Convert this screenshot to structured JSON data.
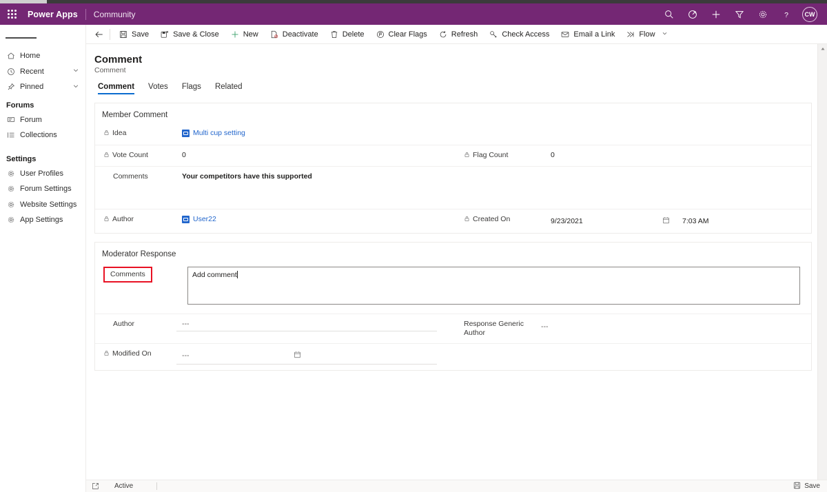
{
  "topbar": {
    "waffle_label": "App launcher",
    "brand": "Power Apps",
    "app_name": "Community",
    "icons": [
      "search-icon",
      "target-icon",
      "plus-icon",
      "filter-icon",
      "gear-icon",
      "help-icon"
    ],
    "avatar_initials": "CW"
  },
  "sidebar": {
    "hamburger_label": "Menu",
    "items": [
      {
        "label": "Home",
        "icon": "home-icon",
        "chevron": false
      },
      {
        "label": "Recent",
        "icon": "clock-icon",
        "chevron": true
      },
      {
        "label": "Pinned",
        "icon": "pin-icon",
        "chevron": true
      }
    ],
    "groups": [
      {
        "title": "Forums",
        "items": [
          {
            "label": "Forum",
            "icon": "forum-icon"
          },
          {
            "label": "Collections",
            "icon": "list-icon"
          }
        ]
      },
      {
        "title": "Settings",
        "items": [
          {
            "label": "User Profiles",
            "icon": "gear-icon"
          },
          {
            "label": "Forum Settings",
            "icon": "gear-icon"
          },
          {
            "label": "Website Settings",
            "icon": "gear-icon"
          },
          {
            "label": "App Settings",
            "icon": "gear-icon"
          }
        ]
      }
    ]
  },
  "commandbar": {
    "back_label": "Back",
    "commands": [
      {
        "label": "Save",
        "icon": "save-icon"
      },
      {
        "label": "Save & Close",
        "icon": "save-close-icon"
      },
      {
        "label": "New",
        "icon": "plus-icon"
      },
      {
        "label": "Deactivate",
        "icon": "deactivate-icon"
      },
      {
        "label": "Delete",
        "icon": "trash-icon"
      },
      {
        "label": "Clear Flags",
        "icon": "clear-flags-icon"
      },
      {
        "label": "Refresh",
        "icon": "refresh-icon"
      },
      {
        "label": "Check Access",
        "icon": "key-icon"
      },
      {
        "label": "Email a Link",
        "icon": "email-link-icon"
      },
      {
        "label": "Flow",
        "icon": "flow-icon",
        "chevron": true
      }
    ]
  },
  "page": {
    "title": "Comment",
    "subtitle": "Comment",
    "tabs": [
      {
        "label": "Comment",
        "active": true
      },
      {
        "label": "Votes",
        "active": false
      },
      {
        "label": "Flags",
        "active": false
      },
      {
        "label": "Related",
        "active": false
      }
    ]
  },
  "member_comment": {
    "section_title": "Member Comment",
    "idea": {
      "label": "Idea",
      "value": "Multi cup setting",
      "locked": true,
      "type": "link"
    },
    "vote_count": {
      "label": "Vote Count",
      "value": "0",
      "locked": true
    },
    "flag_count": {
      "label": "Flag Count",
      "value": "0",
      "locked": true
    },
    "comments": {
      "label": "Comments",
      "value": "Your competitors have this supported",
      "locked": false
    },
    "author": {
      "label": "Author",
      "value": "User22",
      "locked": true,
      "type": "link"
    },
    "created_on": {
      "label": "Created On",
      "date": "9/23/2021",
      "time": "7:03 AM",
      "locked": true
    }
  },
  "moderator_response": {
    "section_title": "Moderator Response",
    "comments": {
      "label": "Comments",
      "value": "Add comment",
      "highlighted": true,
      "highlight_color": "#e81123"
    },
    "author": {
      "label": "Author",
      "value": "---",
      "locked": false
    },
    "response_generic_author": {
      "label": "Response Generic Author",
      "value": "---",
      "locked": false
    },
    "modified_on": {
      "label": "Modified On",
      "value": "---",
      "locked": true
    }
  },
  "statusbar": {
    "expand_label": "Open in new window",
    "state": "Active",
    "save_label": "Save"
  },
  "colors": {
    "brand_purple": "#742774",
    "link_blue": "#2266cc",
    "tab_accent": "#0b6ccf",
    "highlight_red": "#e81123"
  }
}
